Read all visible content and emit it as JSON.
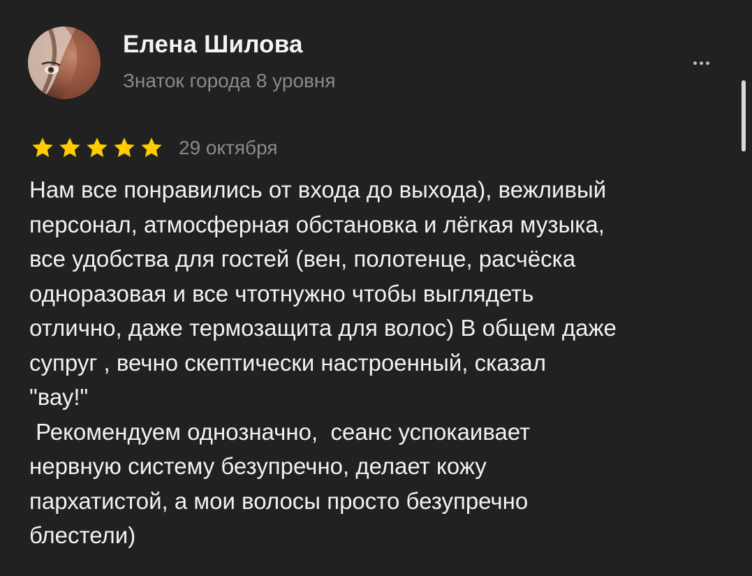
{
  "author": {
    "name": "Елена Шилова",
    "level": "Знаток города 8 уровня"
  },
  "actions": {
    "more_icon": "more-horizontal-icon"
  },
  "review": {
    "rating": 5,
    "rating_max": 5,
    "star_color": "#ffcc00",
    "date": "29 октября",
    "text": "Нам все понравились от входа до выхода), вежливый\nперсонал, атмосферная обстановка и лёгкая музыка,\nвсе удобства для гостей (вен, полотенце, расчёска\nодноразовая и все чтотнужно чтобы выглядеть\nотлично, даже термозащита для волос) В общем даже\nсупруг , вечно скептически настроенный, сказал\n\"вау!\"\n Рекомендуем однозначно,  сеанс успокаивает\nнервную систему безупречно, делает кожу\nпархатистой, а мои волосы просто безупречно\nблестели)"
  },
  "theme": {
    "background": "#212121",
    "text_primary": "#f2f2f2",
    "text_secondary": "#8a8a8a"
  }
}
